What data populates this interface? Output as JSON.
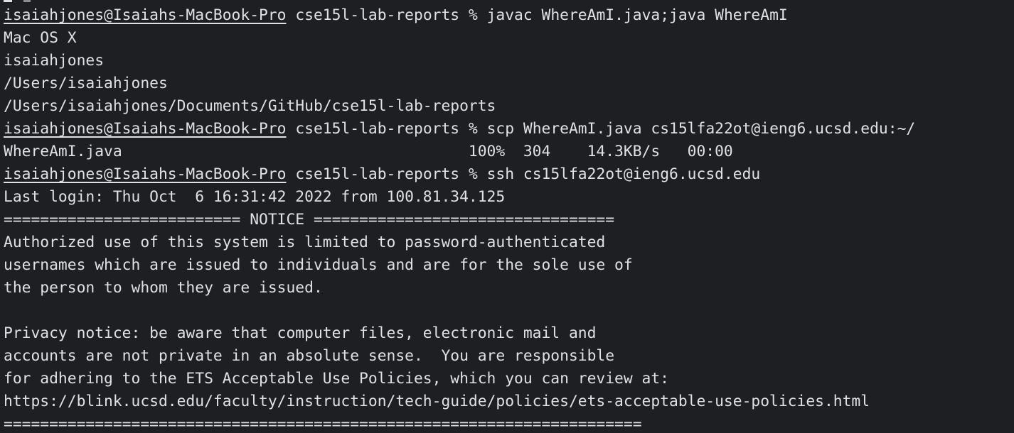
{
  "terminal": {
    "lines": [
      {
        "type": "prompt",
        "user_host": "isaiahjones@Isaiahs-MacBook-Pro",
        "cwd": "cse15l-lab-reports",
        "symbol": "%",
        "command": "javac WhereAmI.java;java WhereAmI"
      },
      {
        "type": "output",
        "text": "Mac OS X"
      },
      {
        "type": "output",
        "text": "isaiahjones"
      },
      {
        "type": "output",
        "text": "/Users/isaiahjones"
      },
      {
        "type": "output",
        "text": "/Users/isaiahjones/Documents/GitHub/cse15l-lab-reports"
      },
      {
        "type": "prompt",
        "user_host": "isaiahjones@Isaiahs-MacBook-Pro",
        "cwd": "cse15l-lab-reports",
        "symbol": "%",
        "command": "scp WhereAmI.java cs15lfa22ot@ieng6.ucsd.edu:~/"
      },
      {
        "type": "output",
        "text": "WhereAmI.java                                      100%  304    14.3KB/s   00:00"
      },
      {
        "type": "prompt",
        "user_host": "isaiahjones@Isaiahs-MacBook-Pro",
        "cwd": "cse15l-lab-reports",
        "symbol": "%",
        "command": "ssh cs15lfa22ot@ieng6.ucsd.edu"
      },
      {
        "type": "output",
        "text": "Last login: Thu Oct  6 16:31:42 2022 from 100.81.34.125"
      },
      {
        "type": "output",
        "text": "========================== NOTICE ================================="
      },
      {
        "type": "output",
        "text": "Authorized use of this system is limited to password-authenticated"
      },
      {
        "type": "output",
        "text": "usernames which are issued to individuals and are for the sole use of"
      },
      {
        "type": "output",
        "text": "the person to whom they are issued."
      },
      {
        "type": "output",
        "text": ""
      },
      {
        "type": "output",
        "text": "Privacy notice: be aware that computer files, electronic mail and"
      },
      {
        "type": "output",
        "text": "accounts are not private in an absolute sense.  You are responsible"
      },
      {
        "type": "output",
        "text": "for adhering to the ETS Acceptable Use Policies, which you can review at:"
      },
      {
        "type": "output",
        "text": "https://blink.ucsd.edu/faculty/instruction/tech-guide/policies/ets-acceptable-use-policies.html"
      },
      {
        "type": "output",
        "text": "======================================================================"
      }
    ]
  },
  "colors": {
    "background": "#1e1f22",
    "foreground": "#dfe1e5"
  }
}
